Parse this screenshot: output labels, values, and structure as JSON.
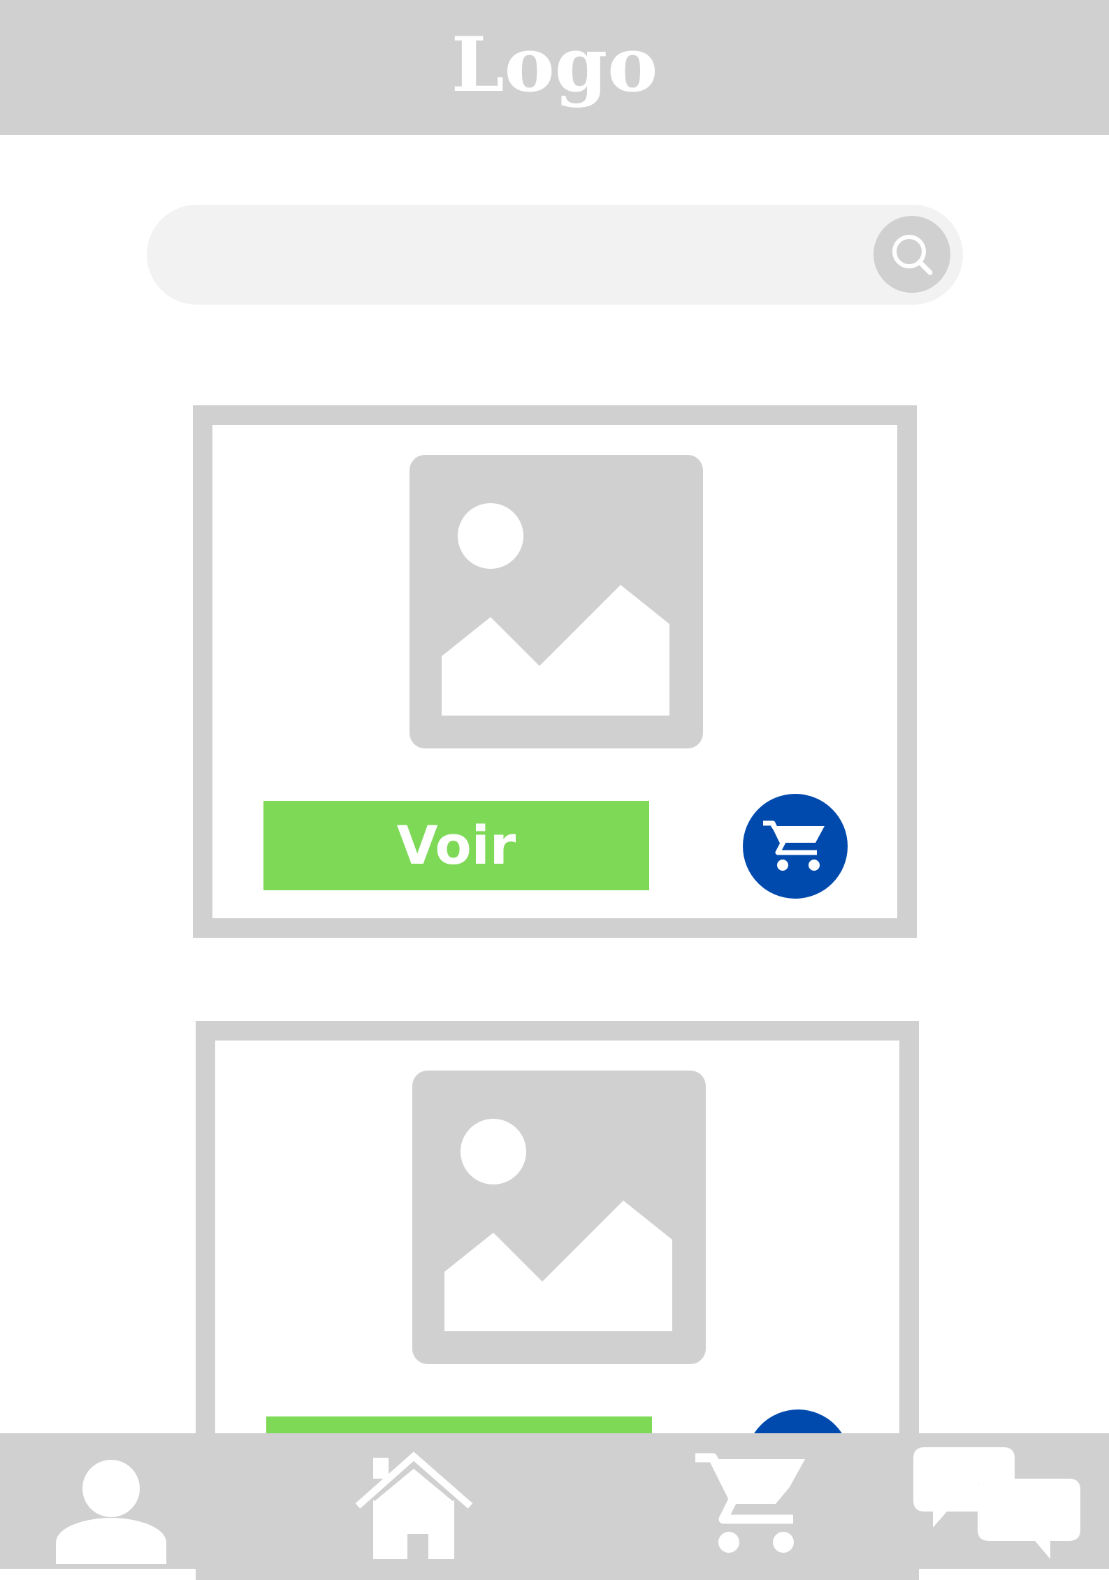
{
  "header": {
    "logo_text": "Logo"
  },
  "search": {
    "value": "",
    "placeholder": "",
    "icon": "search-icon"
  },
  "products": [
    {
      "image_icon": "image-placeholder-icon",
      "view_label": "Voir",
      "cart_icon": "cart-icon"
    },
    {
      "image_icon": "image-placeholder-icon",
      "view_label": "",
      "cart_icon": "cart-icon"
    }
  ],
  "bottom_nav": {
    "items": [
      {
        "id": "profile",
        "icon": "user-icon"
      },
      {
        "id": "home",
        "icon": "home-icon"
      },
      {
        "id": "cart",
        "icon": "cart-icon"
      },
      {
        "id": "chat",
        "icon": "chat-icon"
      }
    ]
  },
  "colors": {
    "gray": "#d0d0d0",
    "search_bg": "#f2f2f2",
    "accent_green": "#7ed957",
    "accent_blue": "#004aad",
    "white": "#ffffff"
  }
}
